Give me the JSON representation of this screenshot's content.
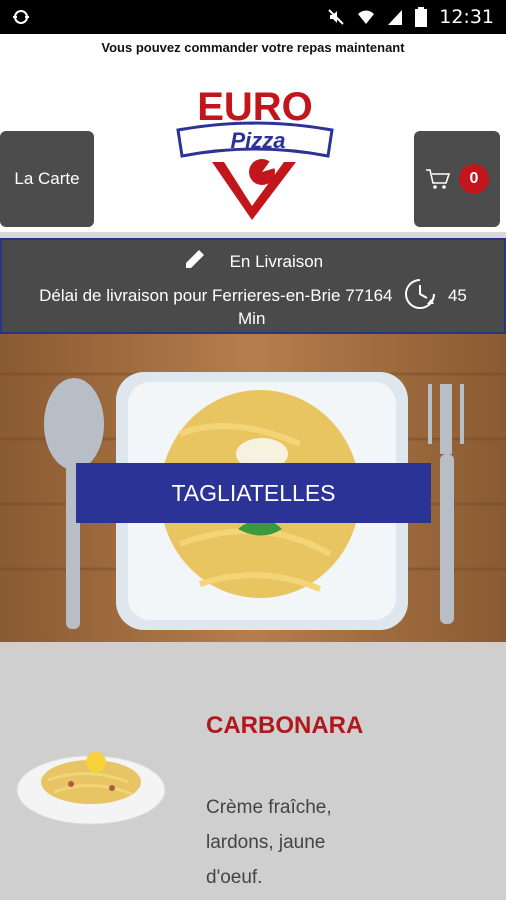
{
  "statusbar": {
    "time": "12:31"
  },
  "tagline": "Vous pouvez commander votre repas maintenant",
  "logo": {
    "word1": "EURO",
    "word2": "Pizza"
  },
  "header": {
    "menu_label": "La Carte",
    "cart_count": "0"
  },
  "delivery": {
    "mode": "En Livraison",
    "text": "Délai de livraison pour Ferrieres-en-Brie 77164",
    "time_value": "45",
    "time_unit": "Min"
  },
  "hero": {
    "title": "TAGLIATELLES"
  },
  "product": {
    "name": "CARBONARA",
    "description": "Crème fraîche, lardons, jaune d'oeuf."
  },
  "colors": {
    "brand_blue": "#2b3397",
    "brand_red": "#c2161c",
    "dark_gray": "#4c4c4c"
  }
}
